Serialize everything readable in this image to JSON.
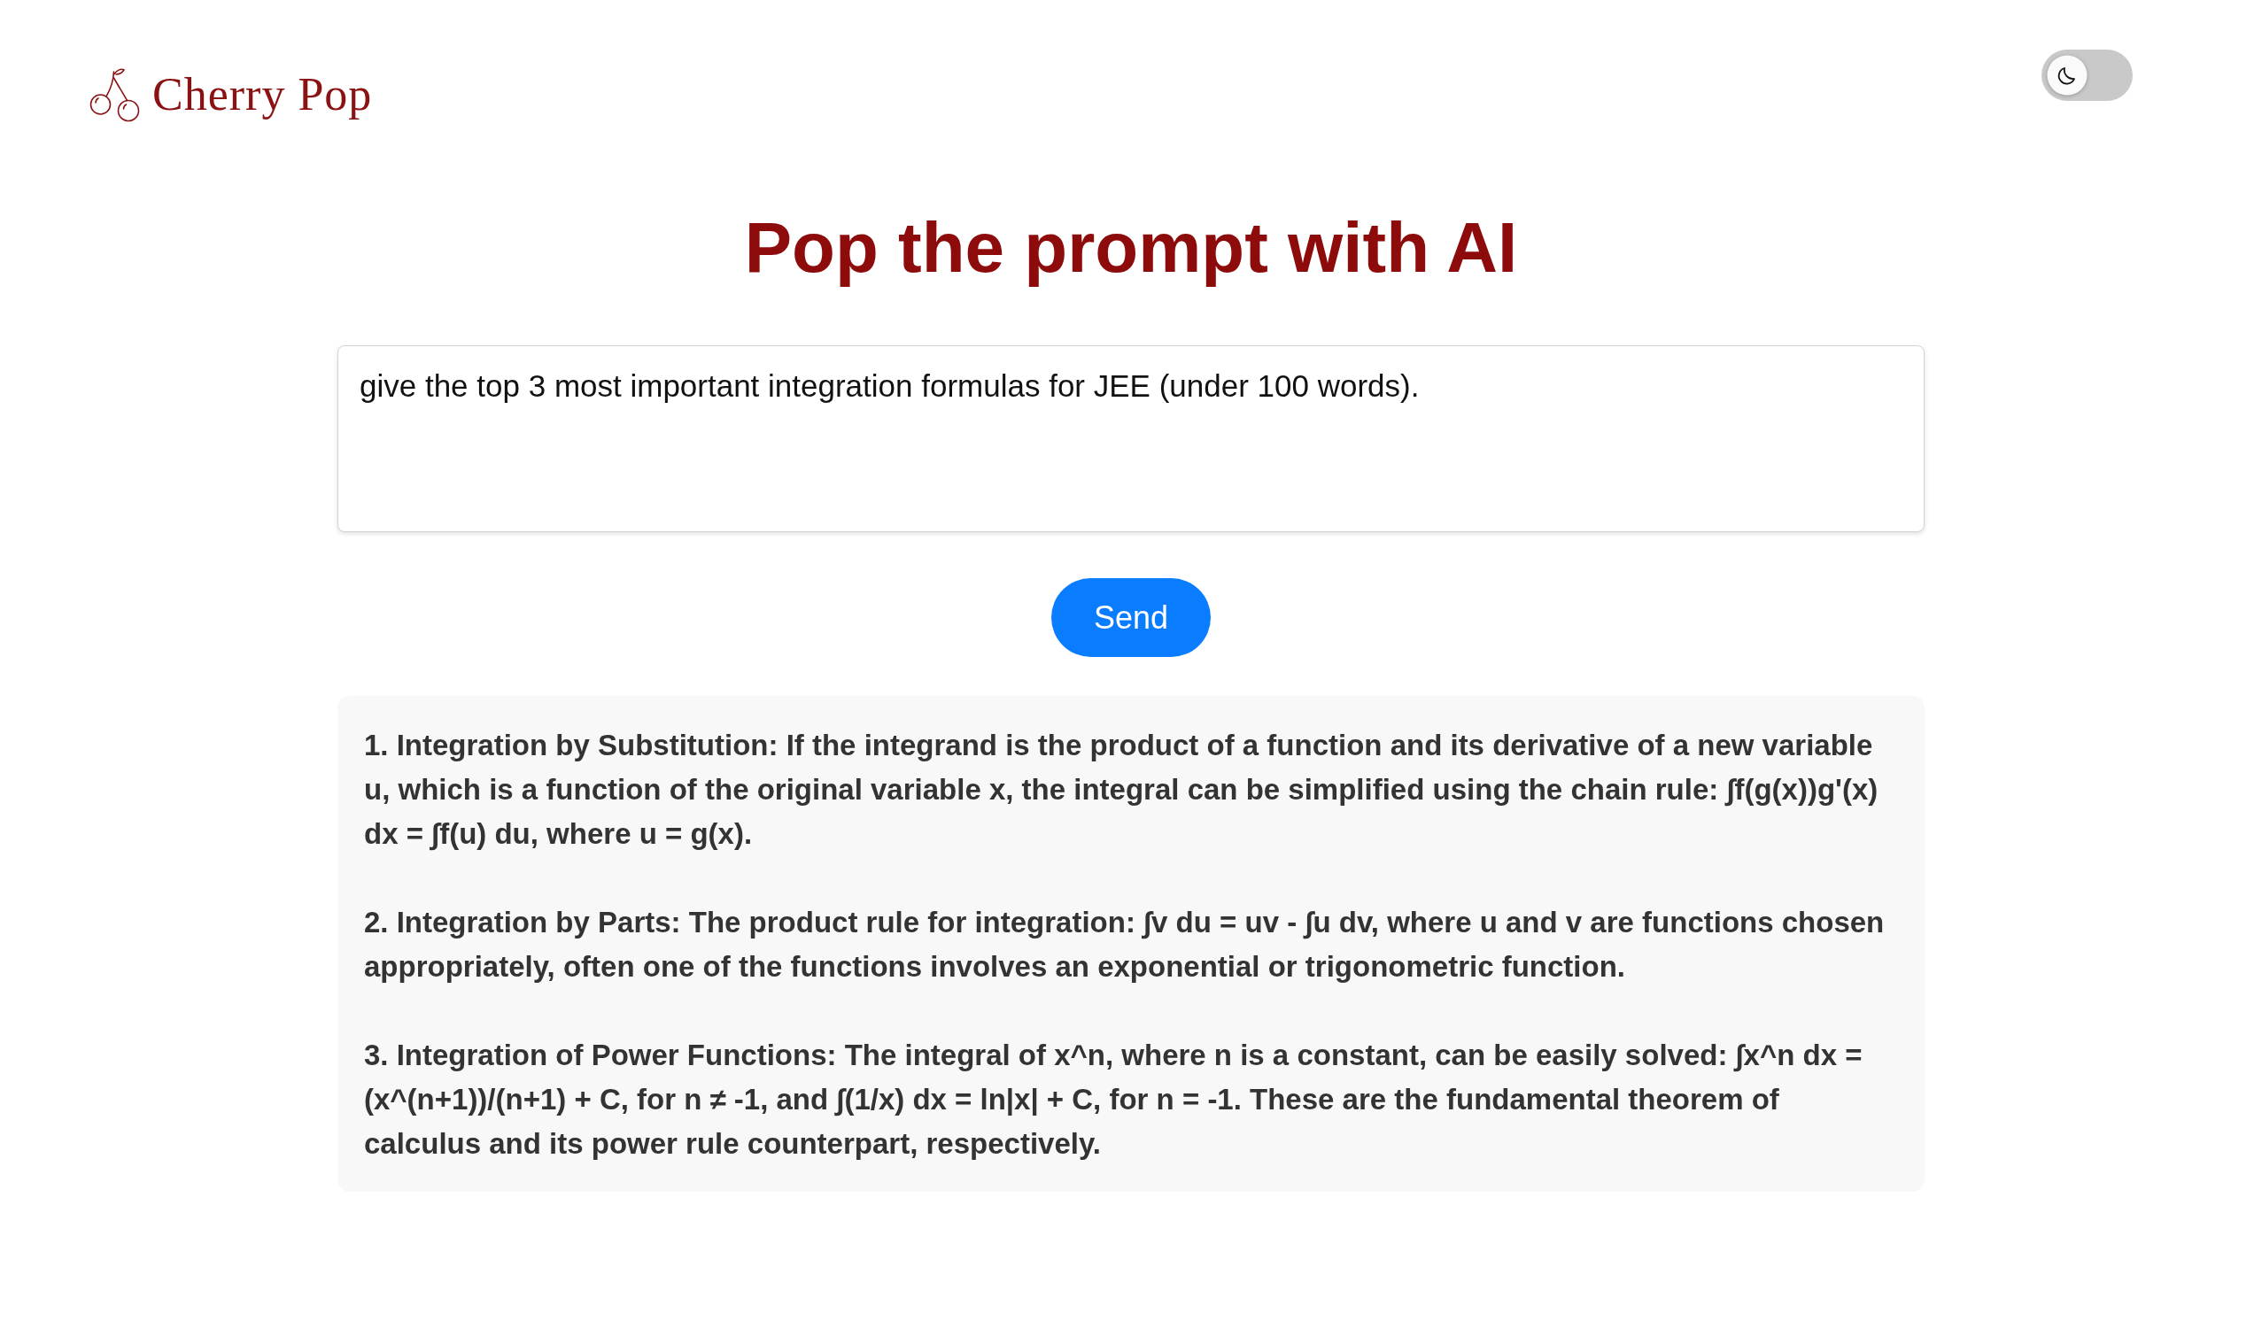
{
  "header": {
    "logo_text": "Cherry Pop",
    "theme_toggle": {
      "on": false
    }
  },
  "title": "Pop the prompt with AI",
  "prompt": {
    "value": "give the top 3 most important integration formulas for JEE (under 100 words)."
  },
  "send_button": "Send",
  "response": {
    "paragraphs": [
      "1. Integration by Substitution: If the integrand is the product of a function and its derivative of a new variable u, which is a function of the original variable x, the integral can be simplified using the chain rule: ∫f(g(x))g'(x) dx = ∫f(u) du, where u = g(x).",
      "2. Integration by Parts: The product rule for integration: ∫v du = uv - ∫u dv, where u and v are functions chosen appropriately, often one of the functions involves an exponential or trigonometric function.",
      "3. Integration of Power Functions: The integral of x^n, where n is a constant, can be easily solved: ∫x^n dx = (x^(n+1))/(n+1) + C, for n ≠ -1, and ∫(1/x) dx = ln|x| + C, for n = -1. These are the fundamental theorem of calculus and its power rule counterpart, respectively."
    ]
  }
}
